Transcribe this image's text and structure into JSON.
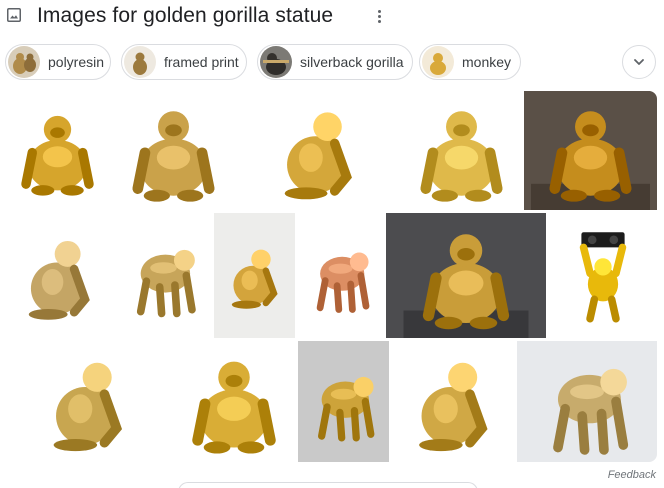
{
  "header": {
    "title": "Images for golden gorilla statue",
    "icon": "image-icon",
    "more_icon": "more-vert-icon"
  },
  "chips": [
    {
      "label": "polyresin",
      "thumb_bg": "#c9b08a"
    },
    {
      "label": "framed print",
      "thumb_bg": "#e9e2d6"
    },
    {
      "label": "silverback gorilla",
      "thumb_bg": "#6b6a66"
    },
    {
      "label": "monkey",
      "thumb_bg": "#f1e6cf"
    }
  ],
  "expand_icon": "chevron-down-icon",
  "colors": {
    "gold": "#d4a52a",
    "gold_light": "#f0cf5e",
    "gold_dark": "#a8791a",
    "copper": "#d98a5f",
    "border": "#dadce0"
  },
  "images": [
    {
      "name": "gold gorilla statue 1",
      "bg": "#ffffff",
      "body": "#d6a52c",
      "pose": "sit",
      "dark": false
    },
    {
      "name": "gold gorilla statue 2",
      "bg": "#ffffff",
      "body": "#caa24a",
      "pose": "sit",
      "dark": false
    },
    {
      "name": "gold gorilla statue 3",
      "bg": "#ffffff",
      "body": "#d4a73a",
      "pose": "side",
      "dark": false
    },
    {
      "name": "gold gorilla statue 4",
      "bg": "#ffffff",
      "body": "#dfb94a",
      "pose": "sit",
      "dark": false
    },
    {
      "name": "gold gorilla statue 5",
      "bg": "#5a5047",
      "body": "#c58d1d",
      "pose": "sit",
      "dark": true
    },
    {
      "name": "gold gorilla statue 6",
      "bg": "#ffffff",
      "body": "#c4a565",
      "pose": "side",
      "dark": false
    },
    {
      "name": "gold gorilla statue 7",
      "bg": "#ffffff",
      "body": "#c7a55a",
      "pose": "walk",
      "dark": false
    },
    {
      "name": "gold gorilla statue 8",
      "bg": "#ededeb",
      "body": "#d3a43c",
      "pose": "side",
      "dark": false
    },
    {
      "name": "copper gorilla statue",
      "bg": "#ffffff",
      "body": "#dc8e63",
      "pose": "walk",
      "dark": false
    },
    {
      "name": "gold gorilla with headphones",
      "bg": "#4c4c4f",
      "body": "#c99d39",
      "pose": "sit",
      "dark": true
    },
    {
      "name": "gold gorilla holding boombox",
      "bg": "#ffffff",
      "body": "#e8b90b",
      "pose": "arms",
      "dark": false
    },
    {
      "name": "gold gorilla statue 9",
      "bg": "#ffffff",
      "body": "#c8a650",
      "pose": "side",
      "dark": false
    },
    {
      "name": "gold gorilla statue 10",
      "bg": "#ffffff",
      "body": "#d9ad36",
      "pose": "sit",
      "dark": false
    },
    {
      "name": "gold gorilla statue 11",
      "bg": "#c9c9c9",
      "body": "#cda33a",
      "pose": "walk",
      "dark": false
    },
    {
      "name": "gold gorilla statue 12",
      "bg": "#ffffff",
      "body": "#d0a845",
      "pose": "side",
      "dark": false
    },
    {
      "name": "gold gorilla statue 13",
      "bg": "#e7e9ec",
      "body": "#c7ab6c",
      "pose": "walk",
      "dark": false
    }
  ],
  "feedback_label": "Feedback"
}
